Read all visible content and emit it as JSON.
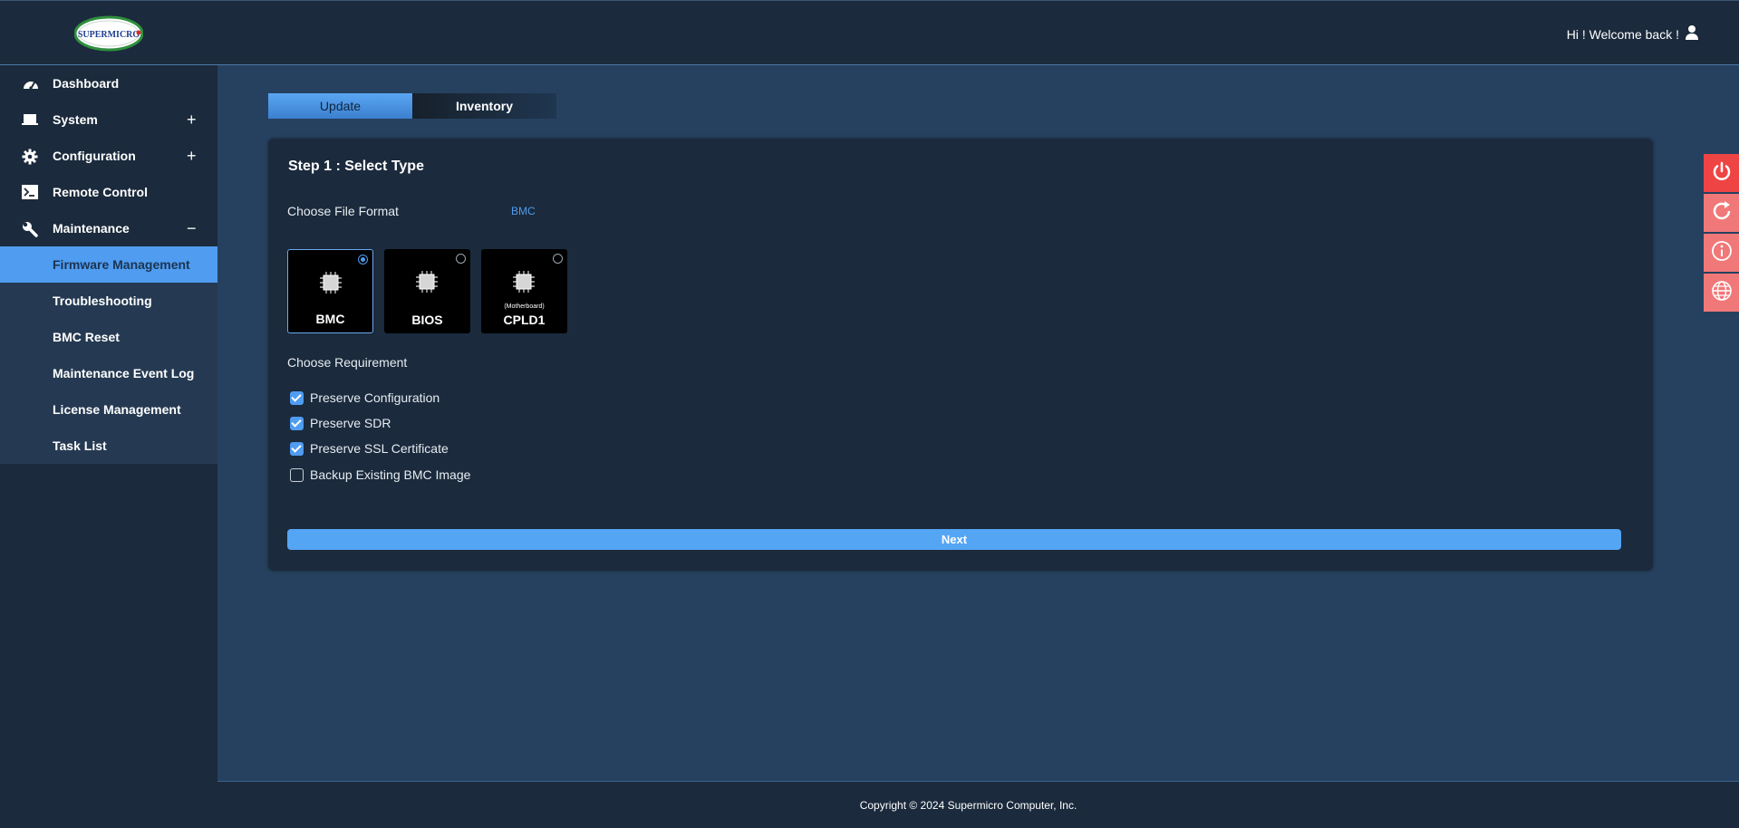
{
  "header": {
    "logo_text": "SUPERMICRO",
    "welcome": "Hi ! Welcome back !",
    "user_icon": "user-icon"
  },
  "sidebar": {
    "items": [
      {
        "label": "Dashboard",
        "icon": "dashboard-icon"
      },
      {
        "label": "System",
        "icon": "laptop-icon",
        "toggle": "+"
      },
      {
        "label": "Configuration",
        "icon": "gear-icon",
        "toggle": "+"
      },
      {
        "label": "Remote Control",
        "icon": "terminal-icon"
      },
      {
        "label": "Maintenance",
        "icon": "wrench-icon",
        "toggle": "−"
      }
    ],
    "submenu": [
      {
        "label": "Firmware Management",
        "active": true
      },
      {
        "label": "Troubleshooting"
      },
      {
        "label": "BMC Reset"
      },
      {
        "label": "Maintenance Event Log"
      },
      {
        "label": "License Management"
      },
      {
        "label": "Task List"
      }
    ]
  },
  "tabs": [
    {
      "label": "Update",
      "active": true
    },
    {
      "label": "Inventory",
      "active": false
    }
  ],
  "card": {
    "step_title": "Step 1 : Select Type",
    "file_format_label": "Choose File Format",
    "file_format_value": "BMC",
    "types": [
      {
        "name": "BMC",
        "sub": "",
        "selected": true
      },
      {
        "name": "BIOS",
        "sub": "",
        "selected": false
      },
      {
        "name": "CPLD1",
        "sub": "(Motherboard)",
        "selected": false
      }
    ],
    "requirement_label": "Choose Requirement",
    "requirements": [
      {
        "label": "Preserve Configuration",
        "checked": true
      },
      {
        "label": "Preserve SDR",
        "checked": true
      },
      {
        "label": "Preserve SSL Certificate",
        "checked": true
      },
      {
        "label": "Backup Existing BMC Image",
        "checked": false
      }
    ],
    "next_label": "Next"
  },
  "side_buttons": [
    "power-icon",
    "refresh-icon",
    "info-icon",
    "globe-icon"
  ],
  "footer": {
    "copyright": "Copyright © 2024 Supermicro Computer, Inc."
  },
  "colors": {
    "accent": "#4f9cf0",
    "panel": "#1b2a3c",
    "background": "#26415f",
    "power_button": "#ee4444",
    "side_button": "#f07878"
  }
}
